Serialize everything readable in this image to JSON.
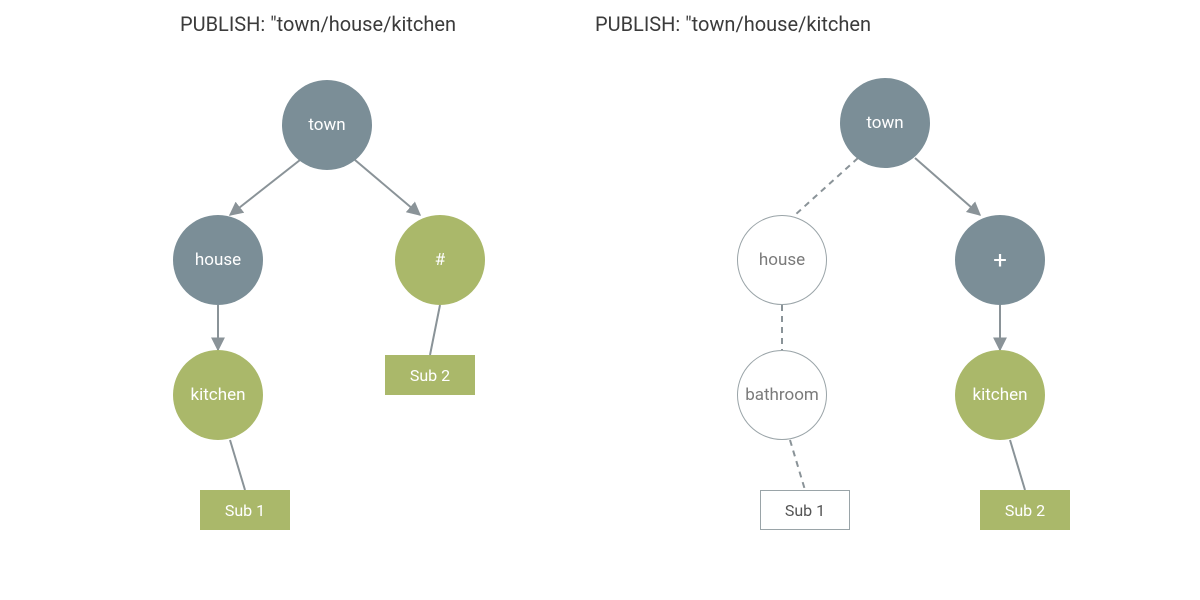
{
  "diagram": {
    "left": {
      "title": "PUBLISH: \"town/house/kitchen",
      "nodes": {
        "town": {
          "label": "town",
          "style": "gray"
        },
        "house": {
          "label": "house",
          "style": "gray"
        },
        "hash": {
          "label": "#",
          "style": "olive"
        },
        "kitchen": {
          "label": "kitchen",
          "style": "olive"
        }
      },
      "subs": {
        "sub1": {
          "label": "Sub 1",
          "style": "olive"
        },
        "sub2": {
          "label": "Sub 2",
          "style": "olive"
        }
      },
      "edges": [
        {
          "from": "town",
          "to": "house",
          "style": "solid-arrow"
        },
        {
          "from": "town",
          "to": "hash",
          "style": "solid-arrow"
        },
        {
          "from": "house",
          "to": "kitchen",
          "style": "solid-arrow"
        },
        {
          "from": "hash",
          "to": "sub2",
          "style": "solid"
        },
        {
          "from": "kitchen",
          "to": "sub1",
          "style": "solid"
        }
      ]
    },
    "right": {
      "title": "PUBLISH: \"town/house/kitchen",
      "nodes": {
        "town": {
          "label": "town",
          "style": "gray"
        },
        "house": {
          "label": "house",
          "style": "hollow"
        },
        "plus": {
          "label": "+",
          "style": "gray"
        },
        "bathroom": {
          "label": "bathroom",
          "style": "hollow"
        },
        "kitchen": {
          "label": "kitchen",
          "style": "olive"
        }
      },
      "subs": {
        "sub1": {
          "label": "Sub 1",
          "style": "hollow"
        },
        "sub2": {
          "label": "Sub 2",
          "style": "olive"
        }
      },
      "edges": [
        {
          "from": "town",
          "to": "house",
          "style": "dashed"
        },
        {
          "from": "town",
          "to": "plus",
          "style": "solid-arrow"
        },
        {
          "from": "house",
          "to": "bathroom",
          "style": "dashed"
        },
        {
          "from": "plus",
          "to": "kitchen",
          "style": "solid-arrow"
        },
        {
          "from": "bathroom",
          "to": "sub1",
          "style": "dashed"
        },
        {
          "from": "kitchen",
          "to": "sub2",
          "style": "solid"
        }
      ]
    }
  },
  "colors": {
    "gray": "#7b8e97",
    "olive": "#aab86a",
    "edge": "#8a9398"
  }
}
